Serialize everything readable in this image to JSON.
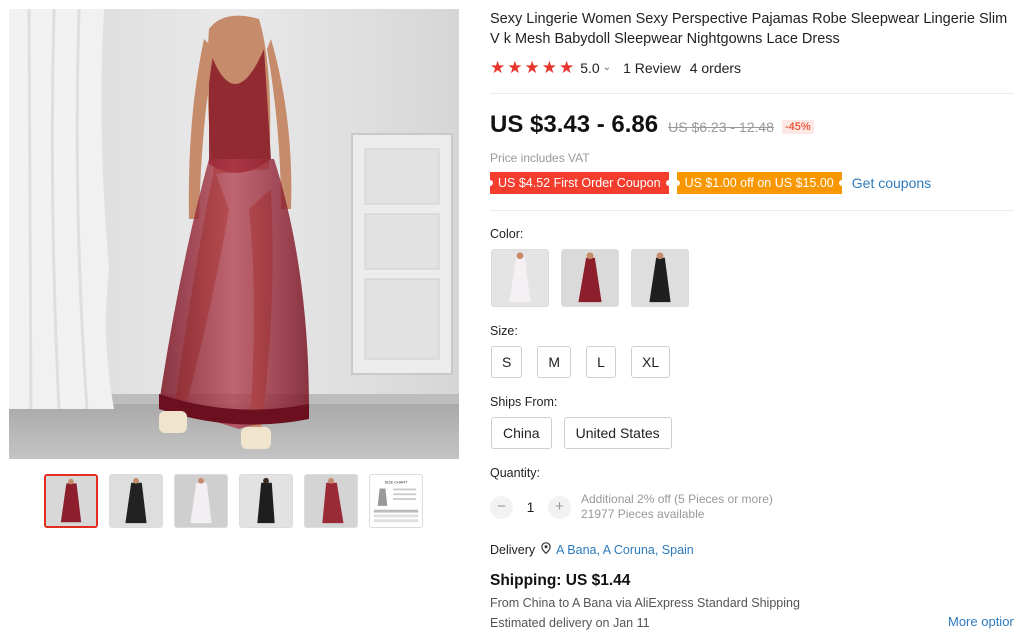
{
  "product": {
    "title": "Sexy Lingerie Women Sexy Perspective Pajamas Robe Sleepwear Lingerie Slim V k Mesh Babydoll Sleepwear Nightgowns Lace Dress",
    "rating": "5.0",
    "rating_chevron": "⌄",
    "reviews": "1 Review",
    "orders": "4 orders"
  },
  "gallery": {
    "thumbnails": [
      "burgundy-front",
      "black-front",
      "white-front",
      "black-back",
      "burgundy-side",
      "size-chart"
    ],
    "active_index": 0,
    "size_chart_label": "SIZE CHART"
  },
  "pricing": {
    "price": "US $3.43 - 6.86",
    "original_price": "US $6.23 - 12.48",
    "discount": "-45%",
    "vat_note": "Price includes VAT",
    "coupon_first_order": "US $4.52 First Order Coupon",
    "coupon_off": "US $1.00 off on US $15.00",
    "get_coupons": "Get coupons"
  },
  "color": {
    "label": "Color:",
    "options": [
      "white",
      "burgundy",
      "black"
    ]
  },
  "size": {
    "label": "Size:",
    "options": [
      "S",
      "M",
      "L",
      "XL"
    ]
  },
  "ships_from": {
    "label": "Ships From:",
    "options": [
      "China",
      "United States"
    ]
  },
  "quantity": {
    "label": "Quantity:",
    "minus": "−",
    "value": "1",
    "plus": "+",
    "discount_note": "Additional 2% off (5 Pieces or more)",
    "available": "21977 Pieces available"
  },
  "delivery": {
    "label": "Delivery",
    "location": "A Bana, A Coruna, Spain"
  },
  "shipping": {
    "title": "Shipping: US $1.44",
    "route": "From China to A Bana via AliExpress Standard Shipping",
    "estimate": "Estimated delivery on Jan 11",
    "more_options": "More options"
  },
  "colors": {
    "accent_red": "#e6352d",
    "link_blue": "#2d7bbd",
    "coupon_orange": "#f89700",
    "burgundy": "#8c1f2b"
  }
}
